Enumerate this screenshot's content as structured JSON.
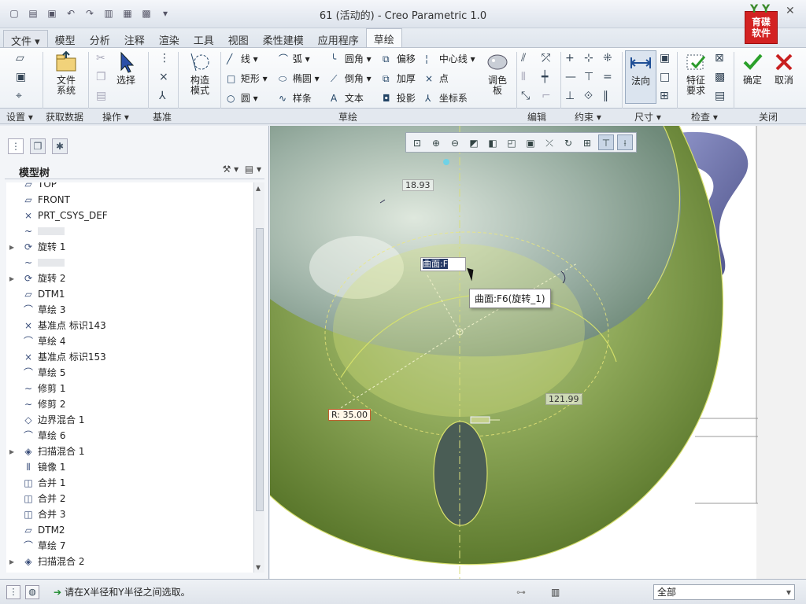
{
  "window": {
    "title": "61 (活动的) - Creo Parametric 1.0",
    "brand_text": "育碟\n软件",
    "help": "?",
    "close": "✕"
  },
  "tabs": [
    {
      "label": "文件 ▾"
    },
    {
      "label": "模型"
    },
    {
      "label": "分析"
    },
    {
      "label": "注释"
    },
    {
      "label": "渲染"
    },
    {
      "label": "工具"
    },
    {
      "label": "视图"
    },
    {
      "label": "柔性建模"
    },
    {
      "label": "应用程序"
    },
    {
      "label": "草绘"
    }
  ],
  "ribbon": {
    "file_system": "文件\n系统",
    "select": "选择",
    "construct_mode": "构造\n模式",
    "line": "线",
    "arc": "弧",
    "fillet": "圆角",
    "offset": "偏移",
    "centerline": "中心线",
    "rect": "矩形",
    "ellipse": "椭圆",
    "chamfer": "倒角",
    "thicken": "加厚",
    "point": "点",
    "circle": "圆",
    "spline": "样条",
    "text": "文本",
    "project": "投影",
    "csys": "坐标系",
    "palette": "调色\n板",
    "normal": "法向",
    "feature_req": "特征\n要求",
    "ok": "确定",
    "cancel": "取消"
  },
  "groups": {
    "setup": "设置 ▾",
    "get_data": "获取数据",
    "operations": "操作 ▾",
    "datum": "基准",
    "sketch": "草绘",
    "edit": "编辑",
    "constrain": "约束 ▾",
    "dimension": "尺寸 ▾",
    "inspect": "检查 ▾",
    "close": "关闭"
  },
  "model_tree": {
    "title": "模型树",
    "items": [
      {
        "label": "TOP",
        "icon": "▱",
        "expand": "",
        "dim": false
      },
      {
        "label": "FRONT",
        "icon": "▱",
        "expand": "",
        "dim": false
      },
      {
        "label": "PRT_CSYS_DEF",
        "icon": "⨯",
        "expand": "",
        "dim": false
      },
      {
        "label": "",
        "icon": "~",
        "expand": "",
        "dim": true
      },
      {
        "label": "旋转 1",
        "icon": "⟳",
        "expand": "▸",
        "dim": false
      },
      {
        "label": "",
        "icon": "~",
        "expand": "",
        "dim": true
      },
      {
        "label": "旋转 2",
        "icon": "⟳",
        "expand": "▸",
        "dim": false
      },
      {
        "label": "DTM1",
        "icon": "▱",
        "expand": "",
        "dim": false
      },
      {
        "label": "草绘 3",
        "icon": "⌒",
        "expand": "",
        "dim": false
      },
      {
        "label": "基准点 标识143",
        "icon": "×",
        "expand": "",
        "dim": false
      },
      {
        "label": "草绘 4",
        "icon": "⌒",
        "expand": "",
        "dim": false
      },
      {
        "label": "基准点 标识153",
        "icon": "×",
        "expand": "",
        "dim": false
      },
      {
        "label": "草绘 5",
        "icon": "⌒",
        "expand": "",
        "dim": false
      },
      {
        "label": "修剪 1",
        "icon": "∼",
        "expand": "",
        "dim": false
      },
      {
        "label": "修剪 2",
        "icon": "∼",
        "expand": "",
        "dim": false
      },
      {
        "label": "边界混合 1",
        "icon": "◇",
        "expand": "",
        "dim": false
      },
      {
        "label": "草绘 6",
        "icon": "⌒",
        "expand": "",
        "dim": false
      },
      {
        "label": "扫描混合 1",
        "icon": "◈",
        "expand": "▸",
        "dim": false
      },
      {
        "label": "镜像 1",
        "icon": "⫴",
        "expand": "",
        "dim": false
      },
      {
        "label": "合并 1",
        "icon": "◫",
        "expand": "",
        "dim": false
      },
      {
        "label": "合并 2",
        "icon": "◫",
        "expand": "",
        "dim": false
      },
      {
        "label": "合并 3",
        "icon": "◫",
        "expand": "",
        "dim": false
      },
      {
        "label": "DTM2",
        "icon": "▱",
        "expand": "",
        "dim": false
      },
      {
        "label": "草绘 7",
        "icon": "⌒",
        "expand": "",
        "dim": false
      },
      {
        "label": "扫描混合 2",
        "icon": "◈",
        "expand": "▸",
        "dim": false
      }
    ]
  },
  "canvas": {
    "dim_top": "18.93",
    "dim_right": "121.99",
    "dim_radius": "R: 35.00",
    "edit_value": "曲面:F",
    "tooltip": "曲面:F6(旋转_1)"
  },
  "status": {
    "message": "请在X半径和Y半径之间选取。",
    "filter": "全部"
  },
  "colors": {
    "accent": "#2e6ebc",
    "surface_green": "#7d9a3a",
    "surface_dark": "#4f6a22",
    "handle_blue": "#6c71a8"
  }
}
